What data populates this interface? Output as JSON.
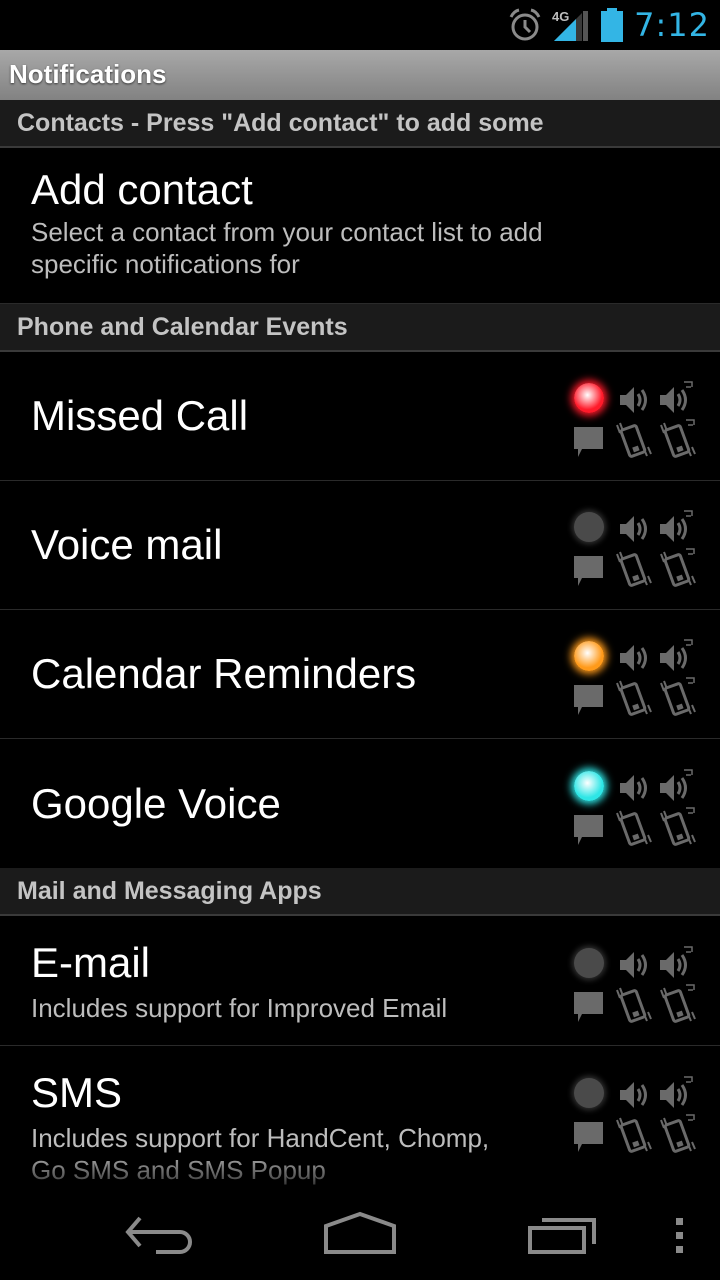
{
  "status_bar": {
    "time": "7:12",
    "network": "4G",
    "icons": [
      "alarm-icon",
      "signal-4g-icon",
      "battery-icon"
    ],
    "time_color": "#33b5e5"
  },
  "title_bar": {
    "title": "Notifications"
  },
  "sections": [
    {
      "header": "Contacts - Press \"Add contact\" to add some",
      "items": [
        {
          "title": "Add contact",
          "subtitle_lines": [
            "Select a contact from your contact list to add",
            "specific notifications for"
          ]
        }
      ]
    },
    {
      "header": "Phone and Calendar Events",
      "items": [
        {
          "title": "Missed Call",
          "led_color": "#ff1a2a",
          "led_enabled": true
        },
        {
          "title": "Voice mail",
          "led_color": "#4a4a4a",
          "led_enabled": false
        },
        {
          "title": "Calendar Reminders",
          "led_color": "#ff9a1a",
          "led_enabled": true
        },
        {
          "title": "Google Voice",
          "led_color": "#2ee6e6",
          "led_enabled": true
        }
      ]
    },
    {
      "header": "Mail and Messaging Apps",
      "items": [
        {
          "title": "E-mail",
          "subtitle_lines": [
            "Includes support for Improved Email"
          ],
          "led_color": "#4a4a4a",
          "led_enabled": false
        },
        {
          "title": "SMS",
          "subtitle_lines": [
            "Includes support for HandCent, Chomp,",
            "Go SMS and SMS Popup"
          ],
          "led_color": "#4a4a4a",
          "led_enabled": false
        }
      ]
    }
  ],
  "indicator_icons": [
    "led-icon",
    "sound-icon",
    "sound-repeat-icon",
    "message-icon",
    "vibrate-icon",
    "vibrate-repeat-icon"
  ],
  "nav_bar": {
    "buttons": [
      "back",
      "home",
      "recent-apps",
      "menu"
    ]
  }
}
